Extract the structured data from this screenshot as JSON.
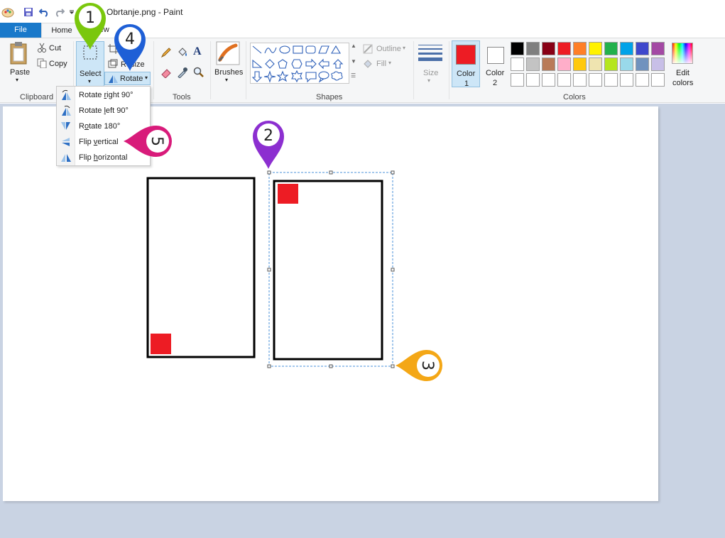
{
  "window": {
    "title": "Obrtanje.png - Paint"
  },
  "tabs": {
    "file": "File",
    "home": "Home",
    "view": "View"
  },
  "clipboard": {
    "paste": "Paste",
    "cut": "Cut",
    "copy": "Copy",
    "group": "Clipboard"
  },
  "image": {
    "select": "Select",
    "crop": "Crop",
    "resize": "Resize",
    "rotate": "Rotate"
  },
  "tools": {
    "group": "Tools"
  },
  "brushes": {
    "label": "Brushes"
  },
  "shapes": {
    "group": "Shapes",
    "outline": "Outline",
    "fill": "Fill"
  },
  "size": {
    "label": "Size"
  },
  "colors": {
    "color1": "Color",
    "color1_num": "1",
    "color2": "Color",
    "color2_num": "2",
    "edit": "Edit",
    "edit2": "colors",
    "group": "Colors",
    "color1_value": "#ed1c24",
    "color2_value": "#ffffff",
    "palette_row1": [
      "#000000",
      "#7f7f7f",
      "#880015",
      "#ed1c24",
      "#ff7f27",
      "#fff200",
      "#22b14c",
      "#00a2e8",
      "#3f48cc",
      "#a349a4"
    ],
    "palette_row2": [
      "#ffffff",
      "#c3c3c3",
      "#b97a57",
      "#ffaec9",
      "#ffc90e",
      "#efe4b0",
      "#b5e61d",
      "#99d9ea",
      "#7092be",
      "#c8bfe7"
    ]
  },
  "rotate_menu": {
    "items": [
      {
        "pre": "Rotate ",
        "key": "r",
        "post": "ight 90°"
      },
      {
        "pre": "Rotate ",
        "key": "l",
        "post": "eft 90°"
      },
      {
        "pre": "R",
        "key": "o",
        "post": "tate 180°"
      },
      {
        "pre": "Flip ",
        "key": "v",
        "post": "ertical"
      },
      {
        "pre": "Flip ",
        "key": "h",
        "post": "orizontal"
      }
    ]
  },
  "callouts": [
    "1",
    "2",
    "3",
    "4",
    "5"
  ]
}
